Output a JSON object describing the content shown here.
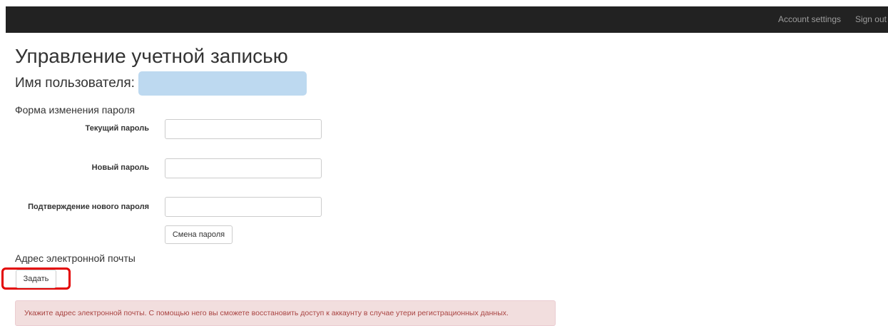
{
  "navbar": {
    "account_settings": "Account settings",
    "sign_out": "Sign out"
  },
  "page": {
    "title": "Управление учетной записью",
    "username_label": "Имя пользователя:"
  },
  "password_form": {
    "title": "Форма изменения пароля",
    "current_label": "Текущий пароль",
    "new_label": "Новый пароль",
    "confirm_label": "Подтверждение нового пароля",
    "current_value": "",
    "new_value": "",
    "confirm_value": "",
    "submit_label": "Смена пароля"
  },
  "email": {
    "title": "Адрес электронной почты",
    "set_label": "Задать",
    "alert_text": "Укажите адрес электронной почты. С помощью него вы сможете восстановить доступ к аккаунту в случае утери регистрационных данных."
  },
  "colors": {
    "navbar_bg": "#222222",
    "highlight": "#e30000",
    "alert_bg": "#f2dede",
    "alert_text": "#a94442",
    "redacted": "#bdd9f0"
  }
}
